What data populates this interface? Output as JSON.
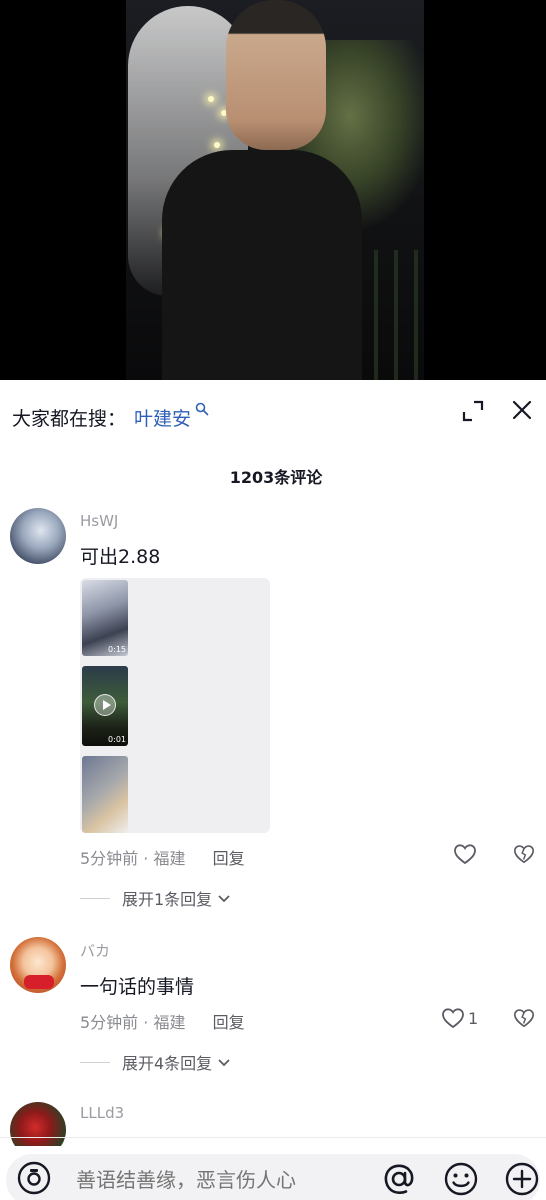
{
  "search_bar": {
    "prefix": "大家都在搜：",
    "keyword": "叶建安"
  },
  "comments_header": {
    "count_label": "1203条评论"
  },
  "comments": [
    {
      "username": "HsWJ",
      "text": "可出2.88",
      "time": "5分钟前",
      "location": "福建",
      "reply_label": "回复",
      "like_count": "",
      "expand_label": "展开1条回复",
      "media": [
        {
          "duration": "0:15"
        },
        {
          "duration": "0:01"
        },
        {
          "duration": ""
        }
      ]
    },
    {
      "username": "バカ",
      "text": "一句话的事情",
      "time": "5分钟前",
      "location": "福建",
      "reply_label": "回复",
      "like_count": "1",
      "expand_label": "展开4条回复"
    },
    {
      "username": "LLLd3"
    }
  ],
  "input_bar": {
    "placeholder": "善语结善缘，恶言伤人心"
  },
  "colors": {
    "keyword_link": "#2f5fb8",
    "text_primary": "#161823",
    "text_secondary": "#8a8b91"
  }
}
